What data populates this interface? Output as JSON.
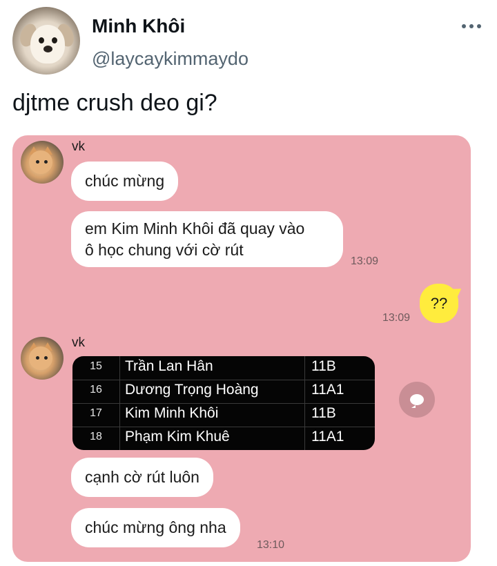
{
  "tweet": {
    "author": {
      "display_name": "Minh Khôi",
      "handle": "@laycaykimmaydo"
    },
    "text": "djtme crush deo gi?",
    "menu_icon": "more-horizontal-icon"
  },
  "chat": {
    "background_color": "#eeaab2",
    "groups": [
      {
        "sender": "vk",
        "messages": [
          {
            "text": "chúc mừng"
          },
          {
            "lines": [
              "em Kim Minh Khôi đã quay vào",
              "ô học chung với cờ rút"
            ],
            "time": "13:09"
          }
        ]
      },
      {
        "sender": "me",
        "messages": [
          {
            "text": "??",
            "time": "13:09",
            "bubble_color": "#ffec3d"
          }
        ]
      },
      {
        "sender": "vk",
        "image_table": {
          "rows": [
            {
              "num": "15",
              "name": "Trần Lan Hân",
              "class": "11B"
            },
            {
              "num": "16",
              "name": "Dương Trọng Hoàng",
              "class": "11A1"
            },
            {
              "num": "17",
              "name": "Kim Minh Khôi",
              "class": "11B"
            },
            {
              "num": "18",
              "name": "Phạm Kim Khuê",
              "class": "11A1"
            }
          ]
        },
        "messages": [
          {
            "text": "cạnh cờ rút luôn"
          },
          {
            "text": "chúc mừng ông nha",
            "time": "13:10"
          }
        ]
      }
    ],
    "share_icon": "share-bubble-icon"
  }
}
